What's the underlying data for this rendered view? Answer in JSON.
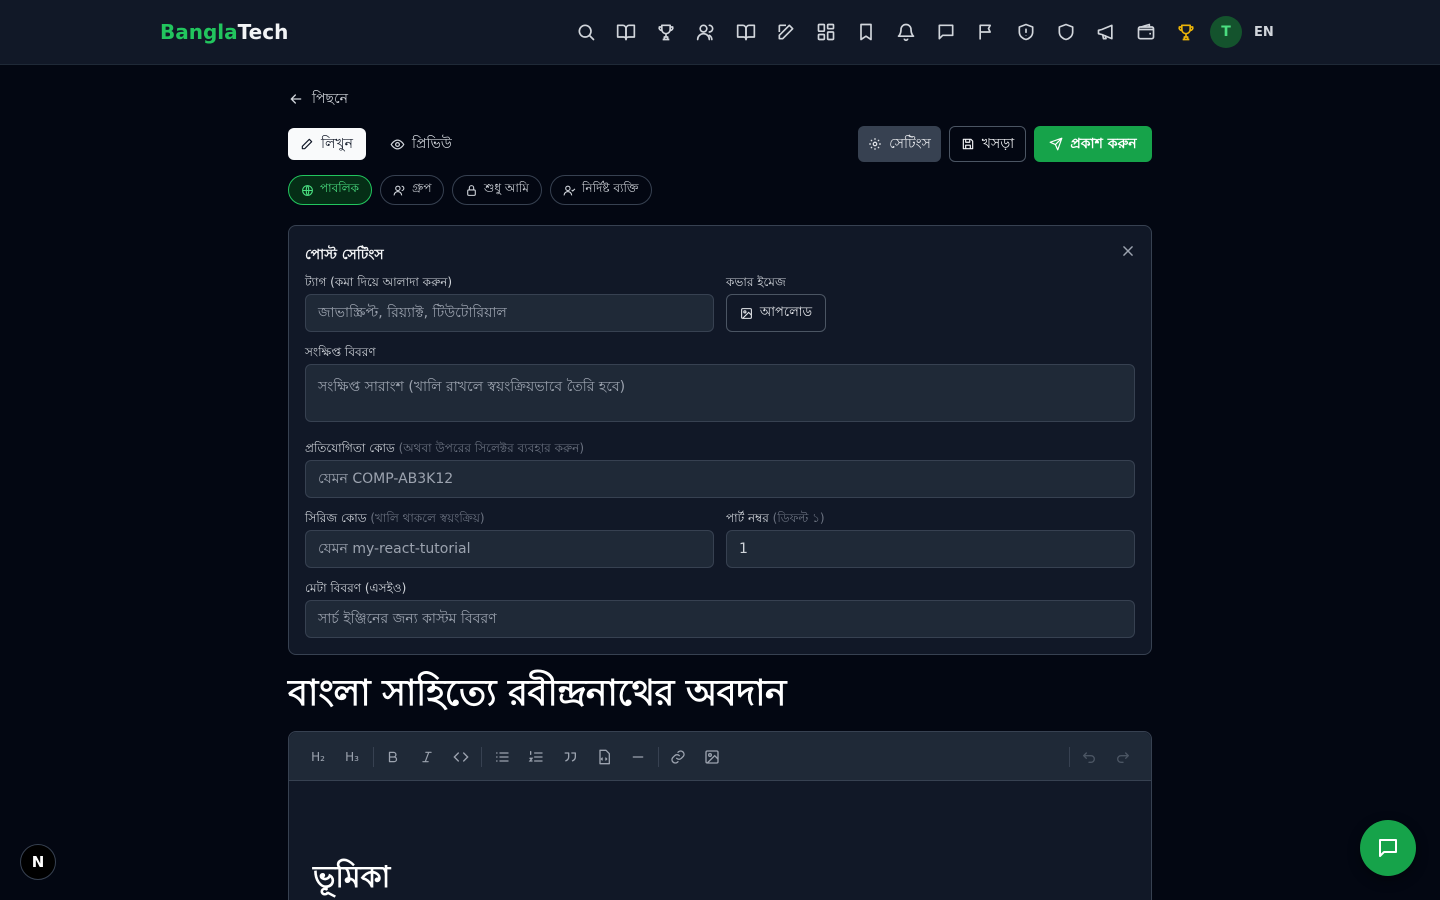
{
  "brand": {
    "part1": "Bangla",
    "part2": "Tech"
  },
  "nav": {
    "icons": [
      "search-icon",
      "book-open-icon",
      "trophy-icon",
      "users-icon",
      "book-icon",
      "edit-icon",
      "grid-icon",
      "bookmark-icon",
      "bell-icon",
      "message-icon",
      "flag-icon",
      "shield-alert-icon",
      "shield-icon",
      "megaphone-icon",
      "wallet-icon",
      "trophy-gold-icon"
    ],
    "avatar_initial": "T",
    "lang": "EN",
    "accent": "#22c55e"
  },
  "back_label": "পিছনে",
  "tabs": {
    "write": "লিখুন",
    "preview": "প্রিভিউ"
  },
  "actions": {
    "settings": "সেটিংস",
    "draft": "খসড়া",
    "publish": "প্রকাশ করুন"
  },
  "visibility": {
    "public": "পাবলিক",
    "group": "গ্রুপ",
    "only_me": "শুধু আমি",
    "specific": "নির্দিষ্ট ব্যক্তি"
  },
  "settings_panel": {
    "title": "পোস্ট সেটিংস",
    "tags_label": "ট্যাগ (কমা দিয়ে আলাদা করুন)",
    "tags_placeholder": "জাভাস্ক্রিপ্ট, রিয়্যাক্ট, টিউটোরিয়াল",
    "cover_label": "কভার ইমেজ",
    "upload_label": "আপলোড",
    "summary_label": "সংক্ষিপ্ত বিবরণ",
    "summary_placeholder": "সংক্ষিপ্ত সারাংশ (খালি রাখলে স্বয়ংক্রিয়ভাবে তৈরি হবে)",
    "competition_label": "প্রতিযোগিতা কোড",
    "competition_hint": "(অথবা উপরের সিলেক্টর ব্যবহার করুন)",
    "competition_placeholder": "যেমন COMP-AB3K12",
    "series_label": "সিরিজ কোড",
    "series_hint": "(খালি থাকলে স্বয়ংক্রিয়)",
    "series_placeholder": "যেমন my-react-tutorial",
    "part_label": "পার্ট নম্বর",
    "part_hint": "(ডিফল্ট ১)",
    "part_value": "1",
    "meta_label": "মেটা বিবরণ (এসইও)",
    "meta_placeholder": "সার্চ ইঞ্জিনের জন্য কাস্টম বিবরণ"
  },
  "post": {
    "title": "বাংলা সাহিত্যে রবীন্দ্রনাথের অবদান",
    "first_heading": "ভূমিকা"
  },
  "toolbar": {
    "h2": "H₂",
    "h3": "H₃"
  },
  "dev_badge": "N"
}
